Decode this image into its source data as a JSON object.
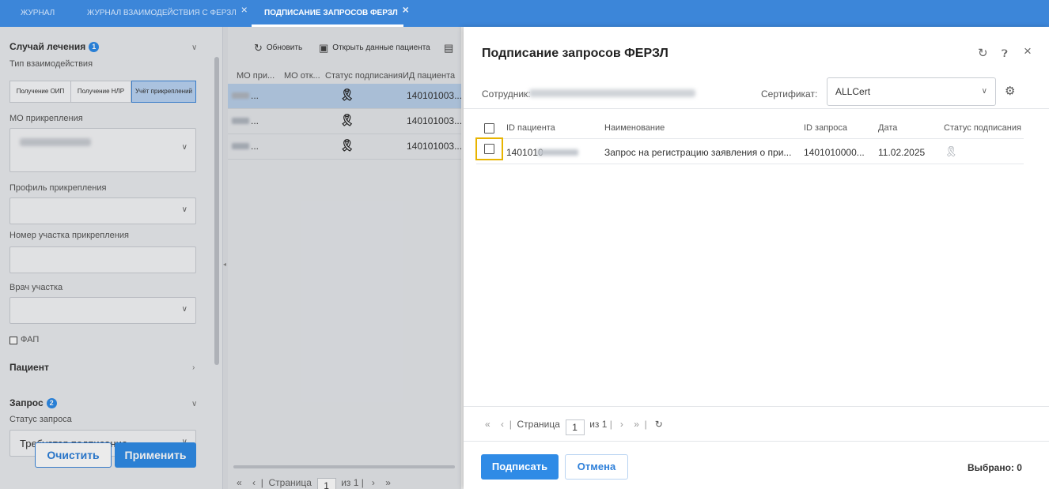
{
  "tabs": [
    {
      "label": "ЖУРНАЛ",
      "closable": false,
      "active": false
    },
    {
      "label": "ЖУРНАЛ ВЗАИМОДЕЙСТВИЯ С ФЕРЗЛ",
      "closable": true,
      "active": false
    },
    {
      "label": "ПОДПИСАНИЕ ЗАПРОСОВ ФЕРЗЛ",
      "closable": true,
      "active": true
    }
  ],
  "colors": {
    "accent": "#3c86d9",
    "primary_button": "#2f8be6",
    "focus": "#e8b400"
  },
  "filters": {
    "case_section": {
      "title": "Случай лечения",
      "badge": "1"
    },
    "interaction_type_label": "Тип взаимодействия",
    "interaction_types": [
      {
        "label": "Получение ОИП",
        "selected": false
      },
      {
        "label": "Получение НЛР",
        "selected": false
      },
      {
        "label": "Учёт прикреплений",
        "selected": true
      }
    ],
    "mo_label": "МО прикрепления",
    "profile_label": "Профиль прикрепления",
    "district_label": "Номер участка прикрепления",
    "doctor_label": "Врач участка",
    "fap_label": "ФАП",
    "patient_section": {
      "title": "Пациент"
    },
    "request_section": {
      "title": "Запрос",
      "badge": "2"
    },
    "request_status_label": "Статус запроса",
    "request_status_value": "Требуется подписание",
    "clear_label": "Очистить",
    "apply_label": "Применить"
  },
  "grid": {
    "toolbar": {
      "refresh": "Обновить",
      "open_patient": "Открыть данные пациента"
    },
    "columns": [
      "МО при...",
      "МО отк...",
      "Статус подписания",
      "ИД пациента"
    ],
    "rows": [
      {
        "name": "...",
        "patient_id": "140101003...",
        "selected": true
      },
      {
        "name": "...",
        "patient_id": "140101003...",
        "selected": false
      },
      {
        "name": "...",
        "patient_id": "140101003...",
        "selected": false
      }
    ],
    "pager": {
      "page_label": "Страница",
      "page": "1",
      "of": "из 1"
    }
  },
  "dialog": {
    "title": "Подписание запросов ФЕРЗЛ",
    "employee_label": "Сотрудник:",
    "certificate_label": "Сертификат:",
    "certificate_value": "ALLCert",
    "columns": [
      "ID пациента",
      "Наименование",
      "ID запроса",
      "Дата",
      "Статус подписания"
    ],
    "rows": [
      {
        "patient_id": "1401010",
        "name": "Запрос на регистрацию заявления о при...",
        "request_id": "1401010000...",
        "date": "11.02.2025"
      }
    ],
    "pager": {
      "page_label": "Страница",
      "page": "1",
      "of": "из 1"
    },
    "sign_label": "Подписать",
    "cancel_label": "Отмена",
    "selected_label": "Выбрано: 0"
  }
}
